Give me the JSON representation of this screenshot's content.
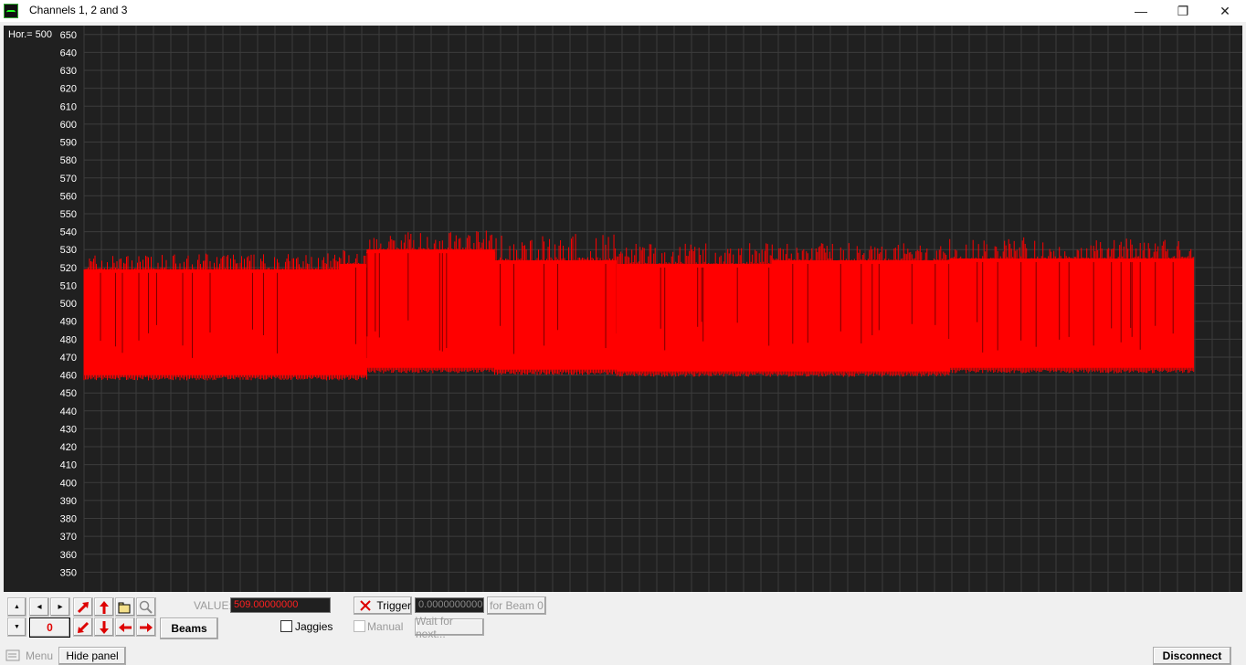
{
  "window": {
    "title": "Channels 1, 2 and 3",
    "minimize": "—",
    "maximize": "❐",
    "close": "✕"
  },
  "chart_data": {
    "type": "line",
    "hor_label": "Hor.= 500",
    "y_ticks": [
      650,
      640,
      630,
      620,
      610,
      600,
      590,
      580,
      570,
      560,
      550,
      540,
      530,
      520,
      510,
      500,
      490,
      480,
      470,
      460,
      450,
      440,
      430,
      420,
      410,
      400,
      390,
      380,
      370,
      360,
      350
    ],
    "ylim": [
      340,
      655
    ],
    "grid": true,
    "series": [
      {
        "color": "#ff0000",
        "segments": [
          {
            "x_from": 0,
            "x_to": 0.23,
            "low": 460,
            "high": 519,
            "spike": 528
          },
          {
            "x_from": 0.23,
            "x_to": 0.255,
            "low": 460,
            "high": 522,
            "spike": 530
          },
          {
            "x_from": 0.255,
            "x_to": 0.37,
            "low": 464,
            "high": 530,
            "spike": 541
          },
          {
            "x_from": 0.37,
            "x_to": 0.48,
            "low": 463,
            "high": 524,
            "spike": 539
          },
          {
            "x_from": 0.48,
            "x_to": 0.62,
            "low": 462,
            "high": 522,
            "spike": 534
          },
          {
            "x_from": 0.62,
            "x_to": 0.78,
            "low": 462,
            "high": 524,
            "spike": 534
          },
          {
            "x_from": 0.78,
            "x_to": 1.0,
            "low": 464,
            "high": 525,
            "spike": 537
          }
        ]
      }
    ]
  },
  "controls": {
    "spin_up": "▲",
    "spin_down": "▼",
    "nav_left": "◂",
    "nav_right": "▸",
    "beam_index": "0",
    "beams_label": "Beams",
    "value_label": "VALUE:",
    "value_text": "509.00000000",
    "trigger_label": "Trigger",
    "trigger_value": "0.0000000000",
    "for_beam_label": "for Beam 0",
    "jaggies_label": "Jaggies",
    "manual_label": "Manual",
    "wait_label": "Wait for next...",
    "menu_label": "Menu",
    "hide_panel_label": "Hide panel",
    "disconnect_label": "Disconnect"
  },
  "colors": {
    "plot_bg": "#202020",
    "grid": "#3c3c3c",
    "signal": "#ff0000",
    "value_text": "#ff2020"
  }
}
